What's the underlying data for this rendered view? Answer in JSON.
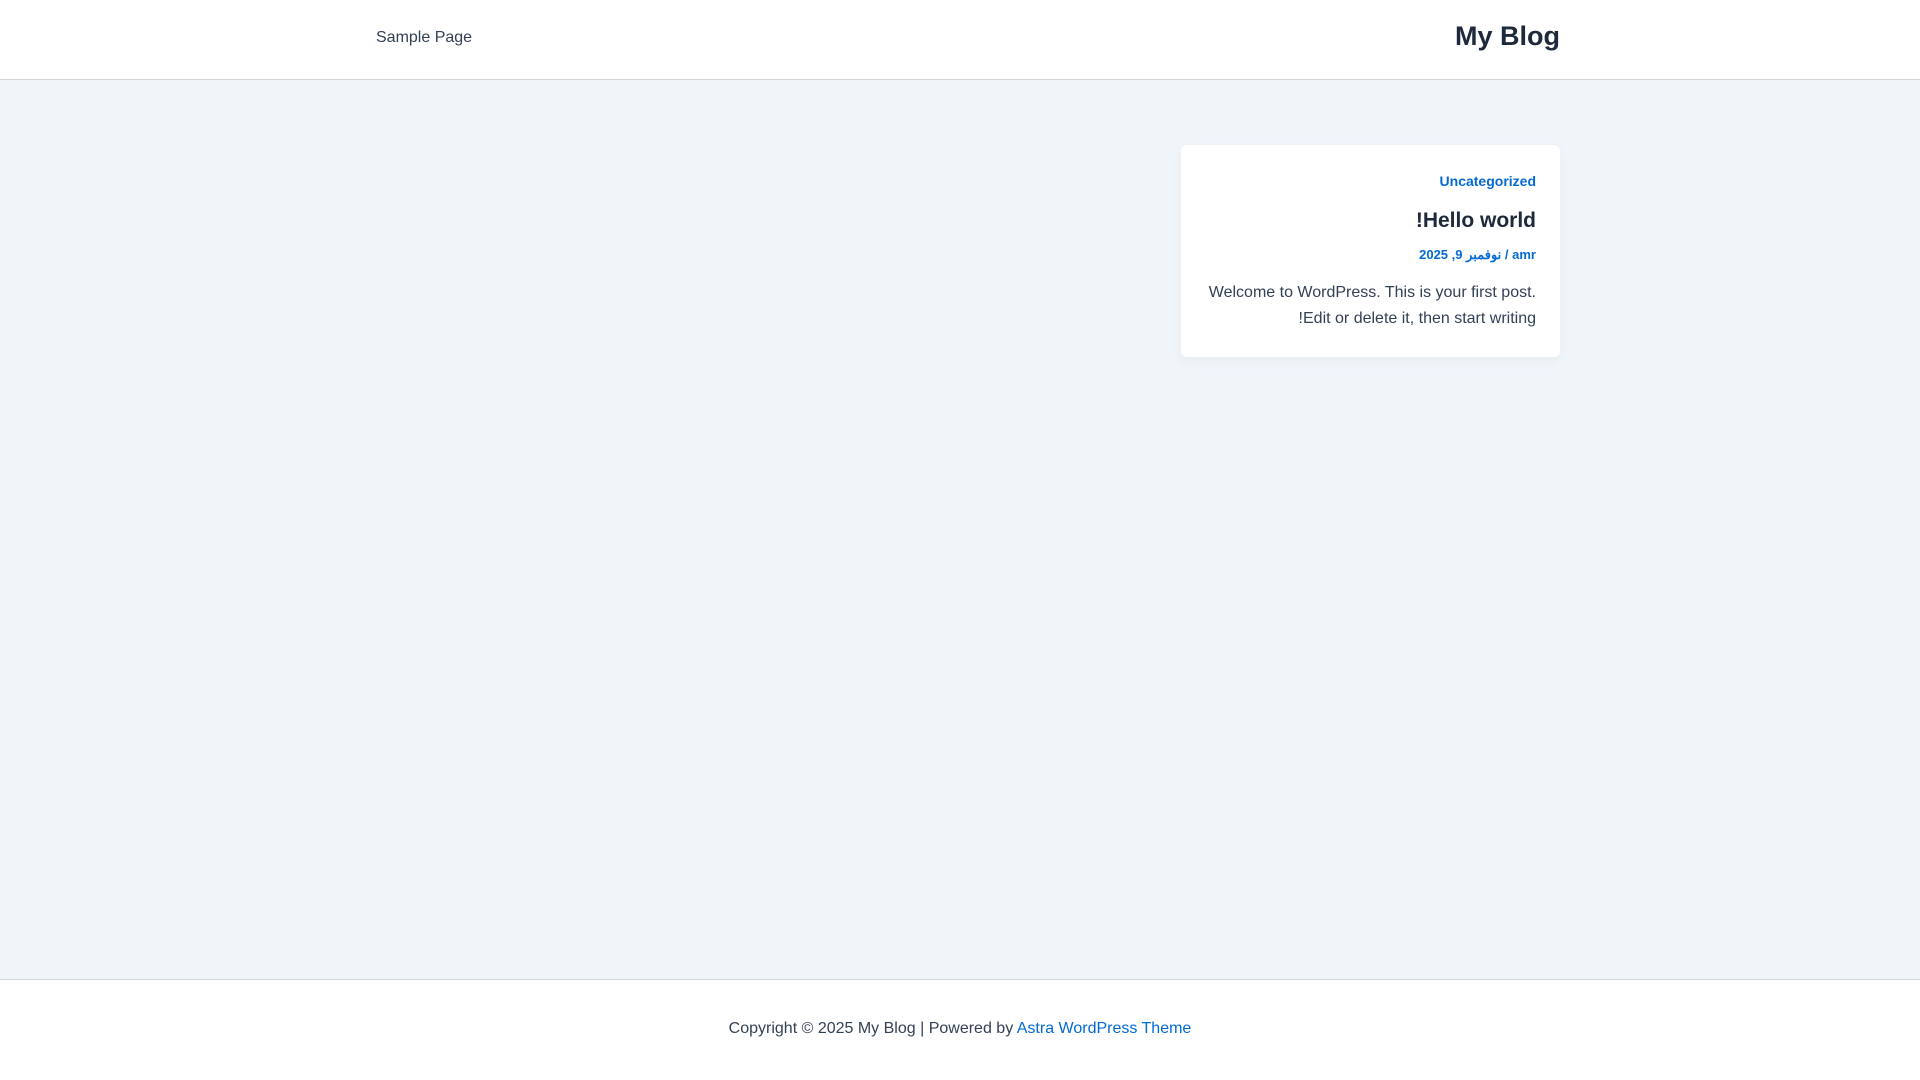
{
  "header": {
    "nav_items": [
      {
        "label": "Sample Page"
      }
    ],
    "site_title": "My Blog"
  },
  "post": {
    "category": "Uncategorized",
    "title": "Hello world!",
    "author": "amr",
    "separator": "/",
    "date": "نوفمبر 9, 2025",
    "excerpt": "Welcome to WordPress. This is your first post. Edit or delete it, then start writing!"
  },
  "footer": {
    "copyright": "Copyright © 2025 My Blog | Powered by ",
    "theme_link": "Astra WordPress Theme"
  },
  "colors": {
    "accent": "#046bd2",
    "background": "#f0f5fa",
    "heading": "#1e293b",
    "text": "#334155"
  }
}
